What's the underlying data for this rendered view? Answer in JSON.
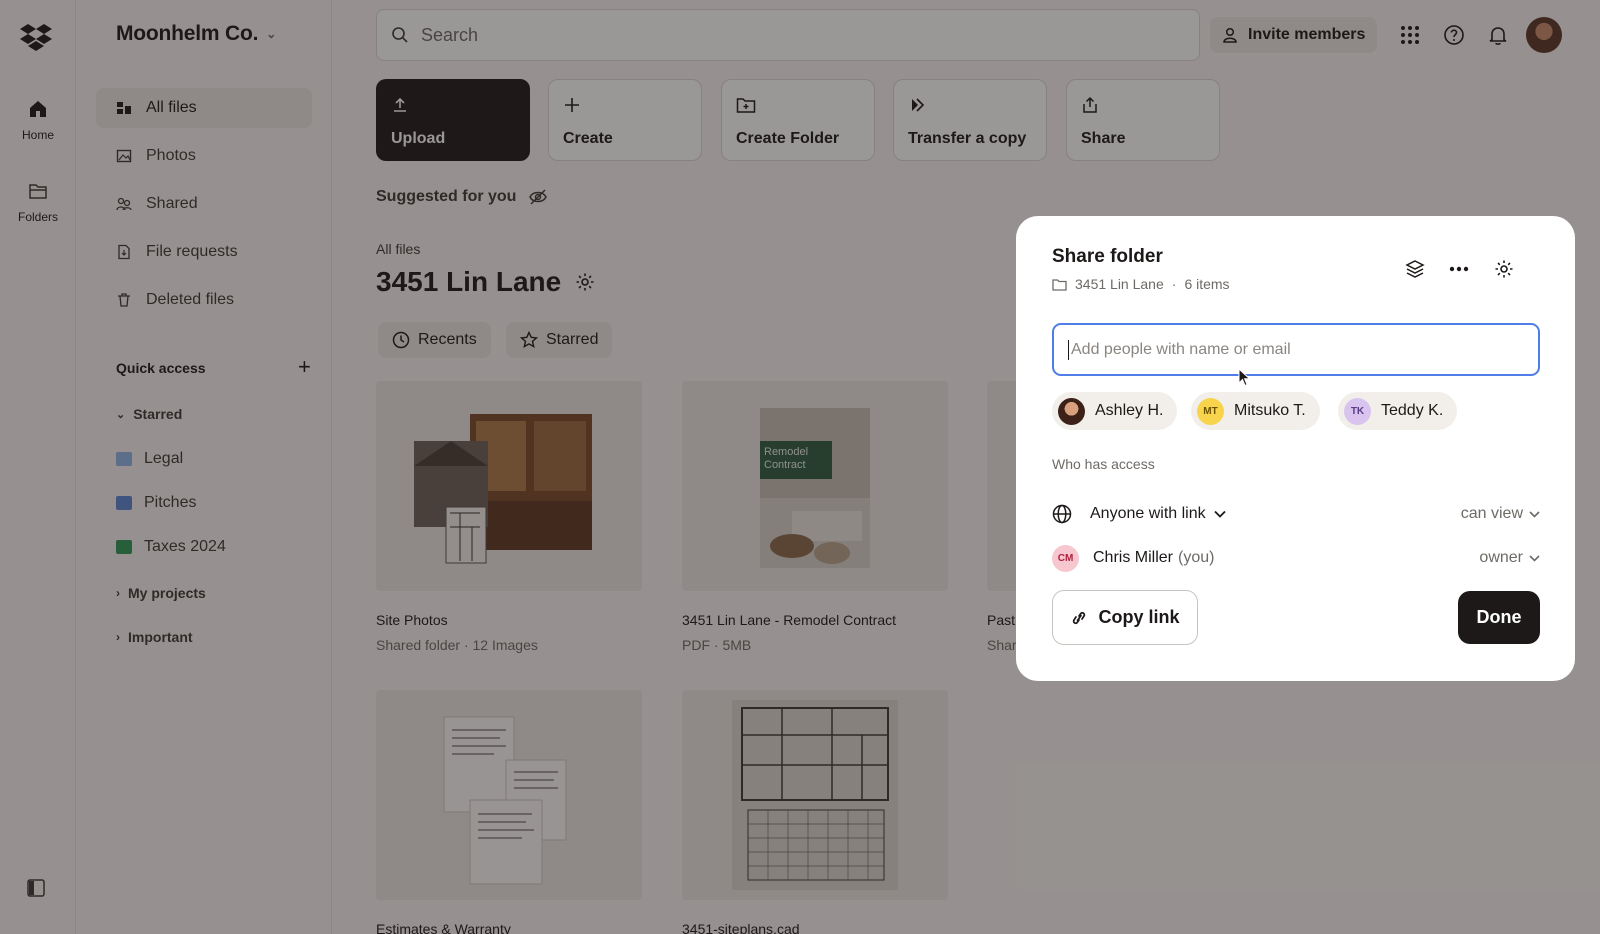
{
  "rail": {
    "home_label": "Home",
    "folders_label": "Folders"
  },
  "sidebar": {
    "org_name": "Moonhelm Co.",
    "nav": [
      {
        "label": "All files",
        "icon": "all-files-icon"
      },
      {
        "label": "Photos",
        "icon": "photos-icon"
      },
      {
        "label": "Shared",
        "icon": "shared-icon"
      },
      {
        "label": "File requests",
        "icon": "file-requests-icon"
      },
      {
        "label": "Deleted files",
        "icon": "trash-icon"
      }
    ],
    "quick_access_title": "Quick access",
    "starred_label": "Starred",
    "starred_items": [
      {
        "label": "Legal",
        "color": "#8fb4e6"
      },
      {
        "label": "Pitches",
        "color": "#5b86d6"
      },
      {
        "label": "Taxes 2024",
        "color": "#2f9a58"
      }
    ],
    "my_projects_label": "My projects",
    "important_label": "Important"
  },
  "topbar": {
    "search_placeholder": "Search",
    "invite_label": "Invite members"
  },
  "actions": [
    {
      "label": "Upload",
      "icon": "upload-icon"
    },
    {
      "label": "Create",
      "icon": "plus-icon"
    },
    {
      "label": "Create Folder",
      "icon": "folder-plus-icon"
    },
    {
      "label": "Transfer a copy",
      "icon": "transfer-icon"
    },
    {
      "label": "Share",
      "icon": "share-icon"
    }
  ],
  "main": {
    "suggested_label": "Suggested for you",
    "breadcrumb": "All files",
    "title": "3451 Lin Lane",
    "chips": [
      "Recents",
      "Starred"
    ],
    "files": [
      {
        "name": "Site Photos",
        "meta": "Shared folder · 12 Images"
      },
      {
        "name": "3451 Lin Lane - Remodel Contract",
        "meta": "PDF · 5MB",
        "thumb_text": "Remodel Contract"
      },
      {
        "name": "Past",
        "meta": "Shar"
      },
      {
        "name": "Estimates & Warranty",
        "meta": ""
      },
      {
        "name": "3451-siteplans.cad",
        "meta": ""
      }
    ]
  },
  "dialog": {
    "title": "Share folder",
    "folder_name": "3451 Lin Lane",
    "separator": "·",
    "item_count": "6 items",
    "input_placeholder": "Add people with name or email",
    "suggestions": [
      {
        "name": "Ashley H.",
        "initials": "",
        "color": "#7a4a35"
      },
      {
        "name": "Mitsuko T.",
        "initials": "MT",
        "color": "#f7d44c"
      },
      {
        "name": "Teddy K.",
        "initials": "TK",
        "color": "#d9c4ef"
      }
    ],
    "who_has_access": "Who has access",
    "link_access": {
      "label": "Anyone with link",
      "permission": "can view"
    },
    "owner": {
      "initials": "CM",
      "name": "Chris Miller",
      "you": "(you)",
      "permission": "owner"
    },
    "copy_link_label": "Copy link",
    "done_label": "Done"
  }
}
